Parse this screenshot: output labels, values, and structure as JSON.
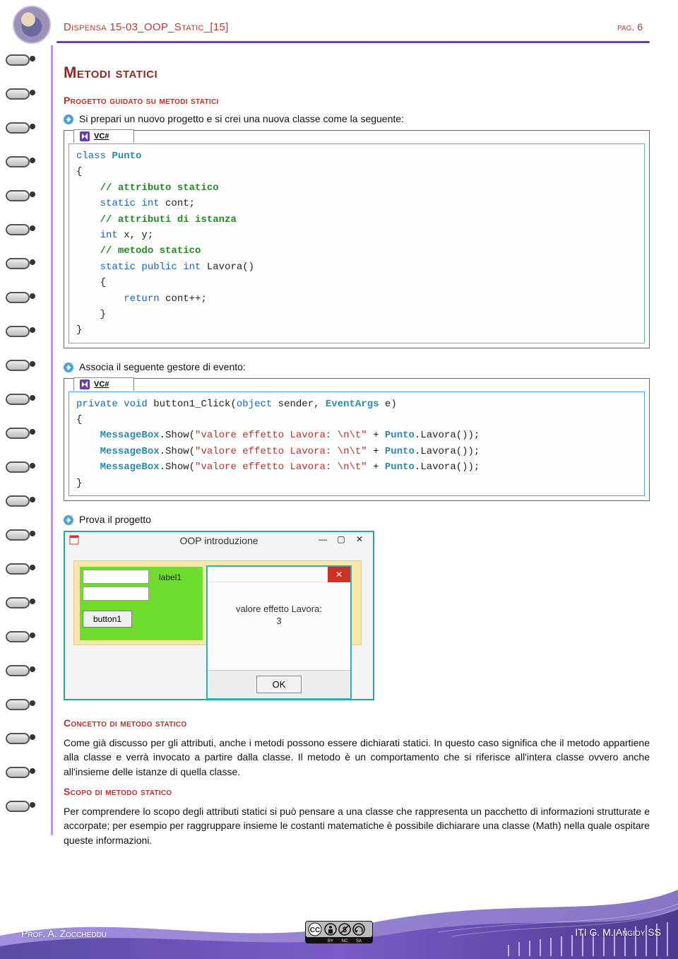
{
  "header": {
    "doc_title": "Dispensa 15-03_OOP_Static_[15]",
    "page_label": "pag. 6"
  },
  "section": {
    "heading": "Metodi statici",
    "sub1": "Progetto guidato su metodi statici",
    "bullet1": "Si prepari un nuovo progetto e si crei una nuova classe come la seguente:",
    "tab1": "VC#",
    "code1": {
      "l01a": "class",
      "l01b": " Punto",
      "l02": "{",
      "l03a": "    ",
      "l03b": "// attributo statico",
      "l04a": "    ",
      "l04b": "static int",
      "l04c": " cont;",
      "l05a": "    ",
      "l05b": "// attributi di istanza",
      "l06a": "    ",
      "l06b": "int",
      "l06c": " x, y;",
      "l07a": "    ",
      "l07b": "// metodo statico",
      "l08a": "    ",
      "l08b": "static public int",
      "l08c": " Lavora()",
      "l09": "    {",
      "l10a": "        ",
      "l10b": "return",
      "l10c": " cont++;",
      "l11": "    }",
      "l12": "}"
    },
    "bullet2": "Associa il seguente gestore di evento:",
    "tab2": "VC#",
    "code2": {
      "l01a": "private void",
      "l01b": " button1_Click(",
      "l01c": "object",
      "l01d": " sender, ",
      "l01e": "EventArgs",
      "l01f": " e)",
      "l02": "{",
      "l03a": "    ",
      "l03b": "MessageBox",
      "l03c": ".Show(",
      "l03d": "\"valore effetto Lavora: \\n\\t\"",
      "l03e": " + ",
      "l03f": "Punto",
      "l03g": ".Lavora());",
      "l04a": "    ",
      "l04b": "MessageBox",
      "l04c": ".Show(",
      "l04d": "\"valore effetto Lavora: \\n\\t\"",
      "l04e": " + ",
      "l04f": "Punto",
      "l04g": ".Lavora());",
      "l05a": "    ",
      "l05b": "MessageBox",
      "l05c": ".Show(",
      "l05d": "\"valore effetto Lavora: \\n\\t\"",
      "l05e": " + ",
      "l05f": "Punto",
      "l05g": ".Lavora());",
      "l06": "}"
    },
    "bullet3": "Prova il progetto",
    "screenshot": {
      "title": "OOP introduzione",
      "label1": "label1",
      "button1": "button1",
      "msg_text": "valore effetto Lavora:",
      "msg_val": "3",
      "ok": "OK"
    },
    "sub2": "Concetto di metodo statico",
    "para1": "Come già discusso per gli attributi, anche i metodi possono essere dichiarati statici. In questo caso significa che il metodo appartiene alla classe e verrà invocato a partire dalla classe. Il metodo è un comportamento che si riferisce all'intera classe ovvero anche all'insieme delle istanze di quella classe.",
    "sub3": "Scopo di metodo statico",
    "para2": "Per comprendere lo scopo degli attributi statici si può pensare a una classe che rappresenta un pacchetto di informazioni strutturate e accorpate; per esempio per raggruppare insieme le costanti matematiche è possibile dichiarare una classe (Math) nella quale ospitare queste informazioni."
  },
  "footer": {
    "left": "Prof. A. Zoccheddu",
    "right": "ITI G. M. Angioy SS"
  }
}
